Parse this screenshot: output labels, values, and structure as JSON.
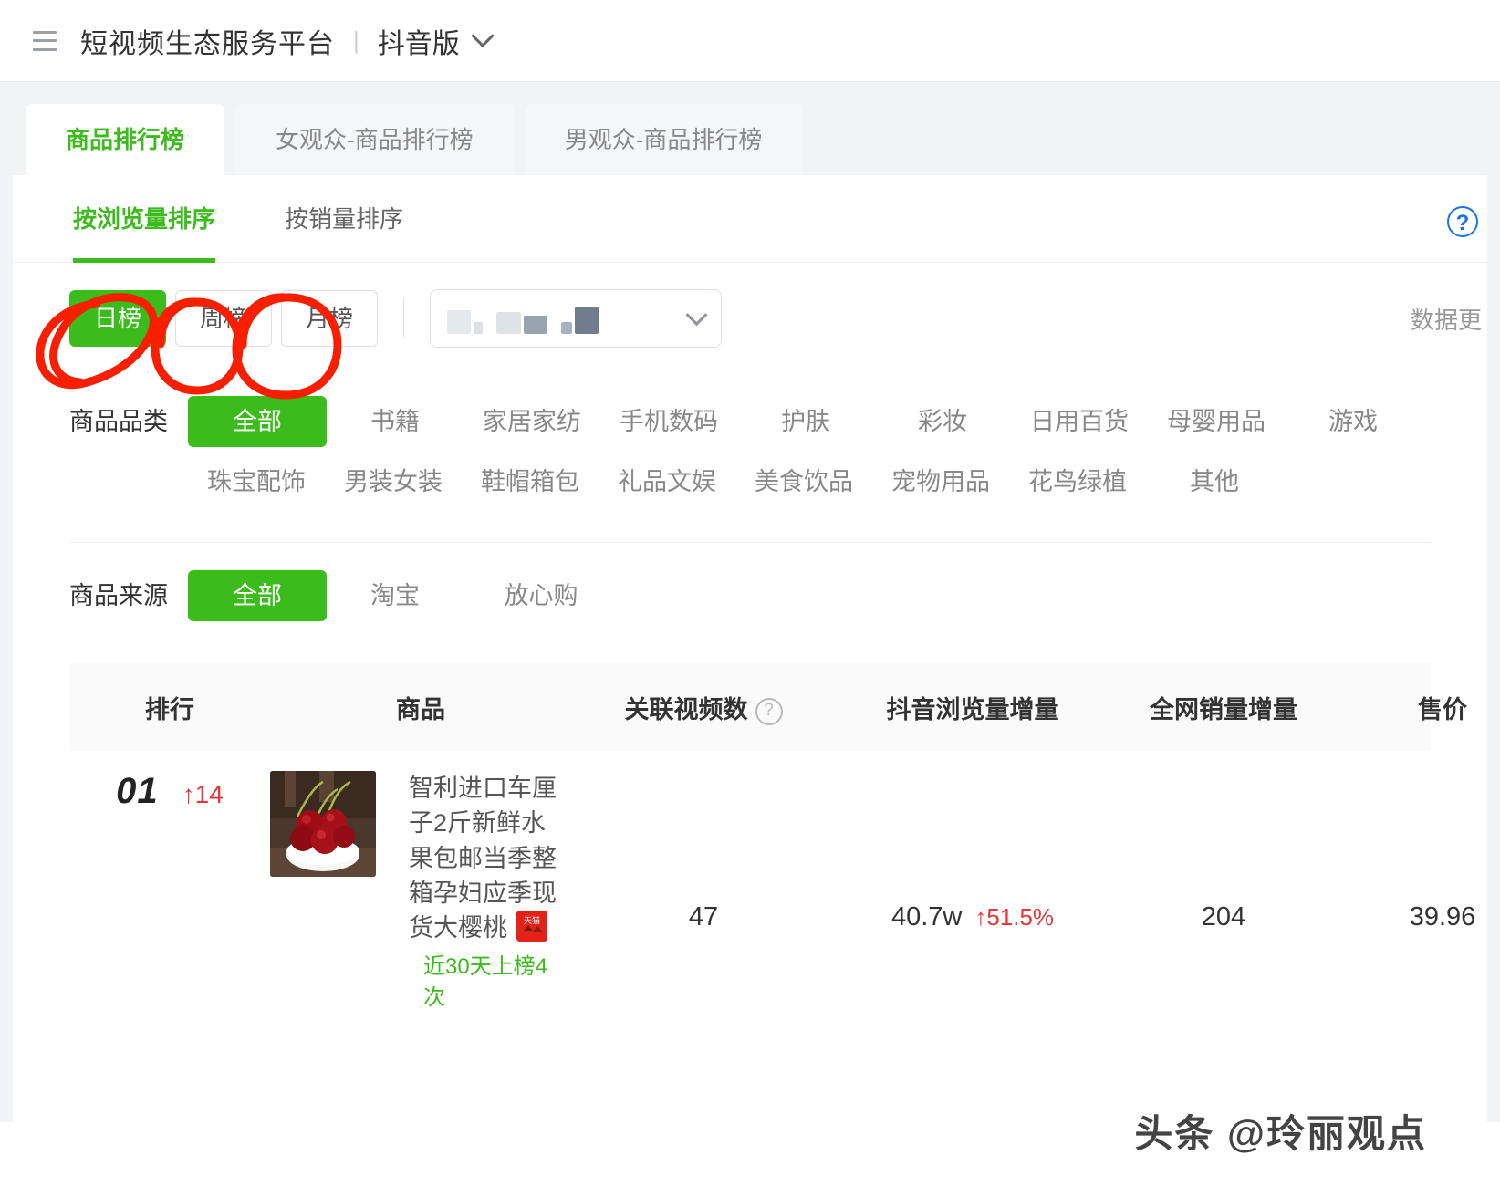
{
  "header": {
    "menu_icon": "hamburger-list-icon",
    "title": "短视频生态服务平台",
    "separator": "|",
    "edition": "抖音版",
    "chevron_icon": "chevron-down-icon"
  },
  "tabs": [
    {
      "label": "商品排行榜",
      "active": true
    },
    {
      "label": "女观众-商品排行榜",
      "active": false
    },
    {
      "label": "男观众-商品排行榜",
      "active": false
    }
  ],
  "subtabs": [
    {
      "label": "按浏览量排序",
      "active": true
    },
    {
      "label": "按销量排序",
      "active": false
    }
  ],
  "help_icon": "?",
  "range": {
    "buttons": [
      {
        "label": "日榜",
        "active": true,
        "annotated": true
      },
      {
        "label": "周榜",
        "active": false,
        "annotated": true
      },
      {
        "label": "月榜",
        "active": false,
        "annotated": true
      }
    ],
    "dropdown_value": "",
    "dropdown_redacted": true,
    "dropdown_chevron_icon": "chevron-down-icon",
    "data_note": "数据更"
  },
  "filters": {
    "category": {
      "label": "商品品类",
      "items": [
        "全部",
        "书籍",
        "家居家纺",
        "手机数码",
        "护肤",
        "彩妆",
        "日用百货",
        "母婴用品",
        "游戏",
        "珠宝配饰",
        "男装女装",
        "鞋帽箱包",
        "礼品文娱",
        "美食饮品",
        "宠物用品",
        "花鸟绿植",
        "其他"
      ],
      "active": "全部"
    },
    "source": {
      "label": "商品来源",
      "items": [
        "全部",
        "淘宝",
        "放心购"
      ],
      "active": "全部"
    }
  },
  "table": {
    "columns": [
      {
        "key": "rank",
        "label": "排行"
      },
      {
        "key": "prod",
        "label": "商品"
      },
      {
        "key": "vid",
        "label": "关联视频数",
        "help": "?"
      },
      {
        "key": "views",
        "label": "抖音浏览量增量"
      },
      {
        "key": "sales",
        "label": "全网销量增量"
      },
      {
        "key": "price",
        "label": "售价"
      }
    ],
    "rows": [
      {
        "rank": "01",
        "rank_delta": "↑14",
        "thumb_alt": "cherries-in-white-bowl",
        "title": "智利进口车厘子2斤新鲜水果包邮当季整箱孕妇应季现货大樱桃",
        "badge": "天猫",
        "onlist": "近30天上榜4次",
        "vid": "47",
        "views": "40.7w",
        "views_pct": "↑51.5%",
        "sales": "204",
        "price": "39.96"
      }
    ]
  },
  "watermark": "头条 @玲丽观点",
  "colors": {
    "accent_green": "#3cbc1c",
    "alert_red": "#e4393c",
    "annotation_red": "#f81f00",
    "help_blue": "#1a73e8",
    "page_bg": "#f2f3f5"
  }
}
